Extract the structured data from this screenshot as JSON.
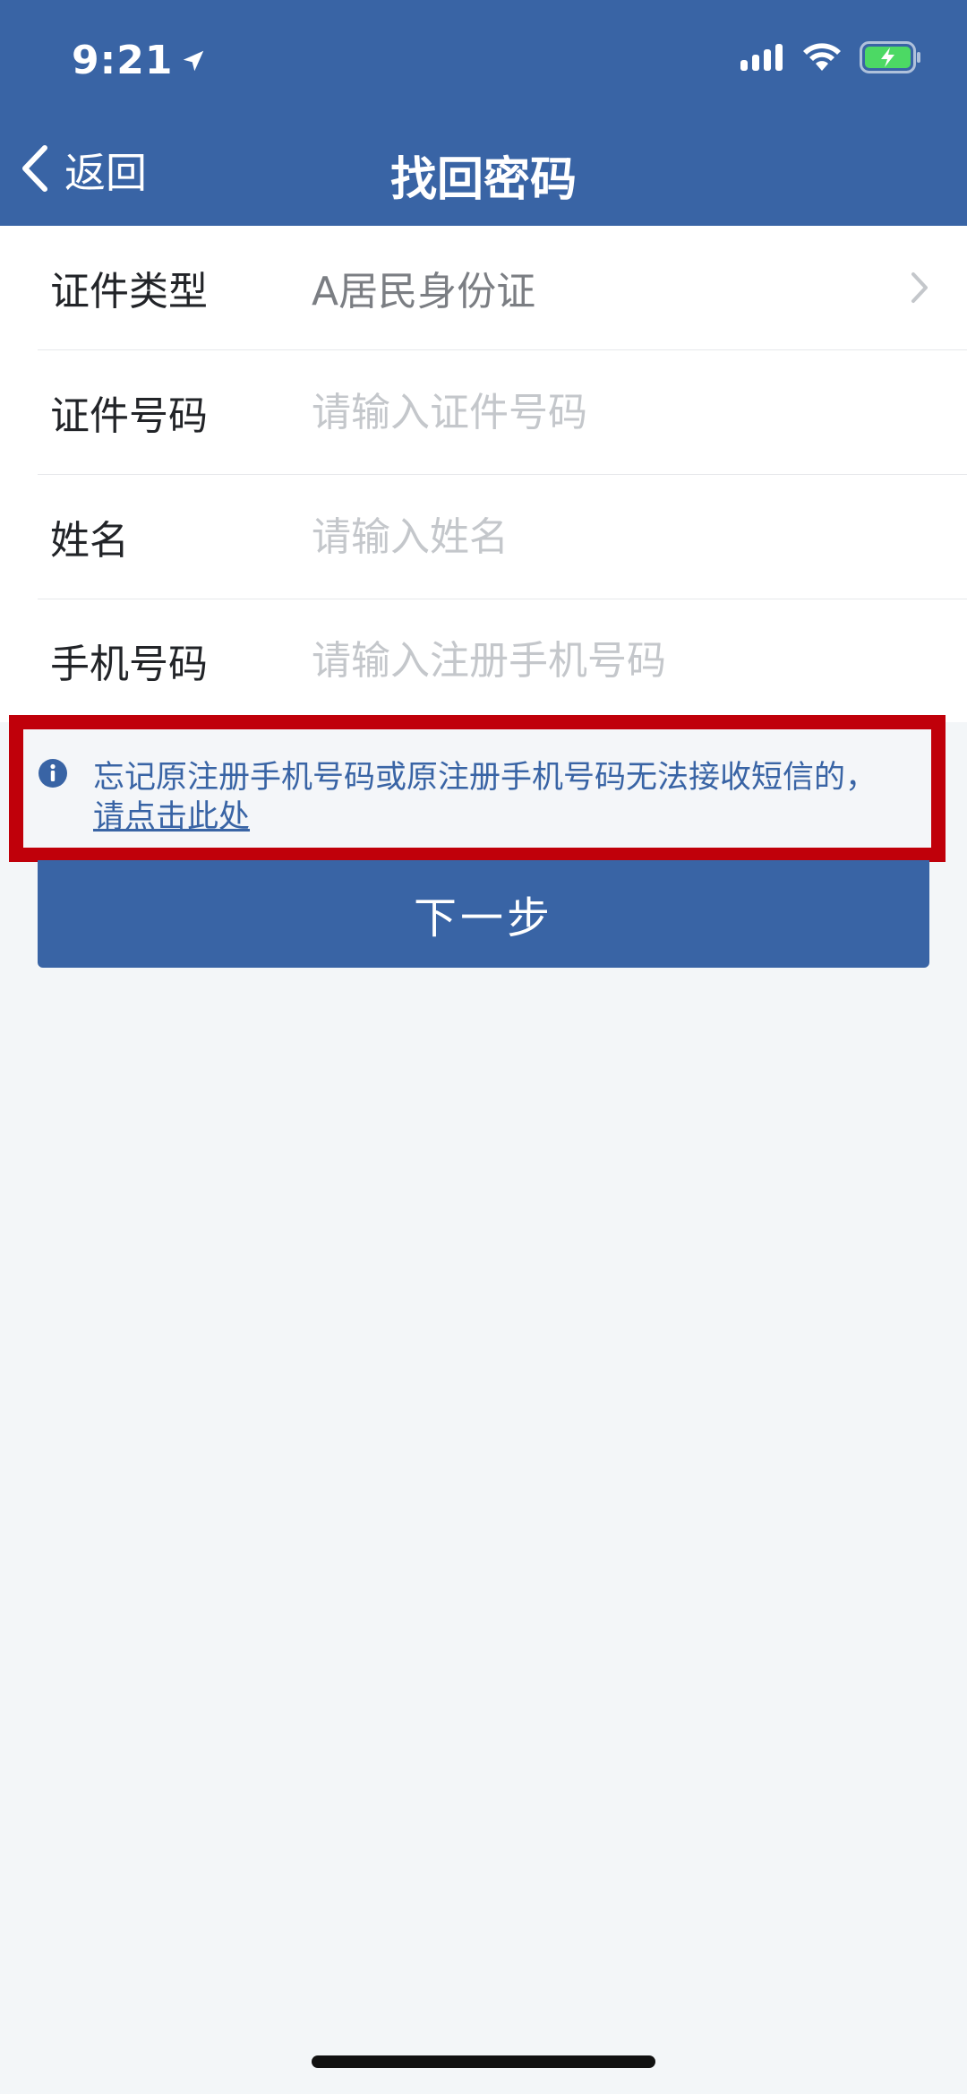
{
  "status_bar": {
    "time": "9:21",
    "location_icon": "location-arrow-icon",
    "signal_icon": "cellular-signal-icon",
    "wifi_icon": "wifi-icon",
    "battery_icon": "battery-charging-icon",
    "battery_color": "#4cd964"
  },
  "header": {
    "back_label": "返回",
    "title": "找回密码",
    "background": "#3964a5"
  },
  "form": {
    "rows": [
      {
        "label": "证件类型",
        "value": "A居民身份证"
      },
      {
        "label": "证件号码",
        "placeholder": "请输入证件号码"
      },
      {
        "label": "姓名",
        "placeholder": "请输入姓名"
      },
      {
        "label": "手机号码",
        "placeholder": "请输入注册手机号码"
      }
    ]
  },
  "notice": {
    "icon": "info-icon",
    "text": "忘记原注册手机号码或原注册手机号码无法接收短信的，",
    "link_text": "请点击此处",
    "highlight_color": "#c0000a"
  },
  "actions": {
    "next_label": "下一步"
  }
}
